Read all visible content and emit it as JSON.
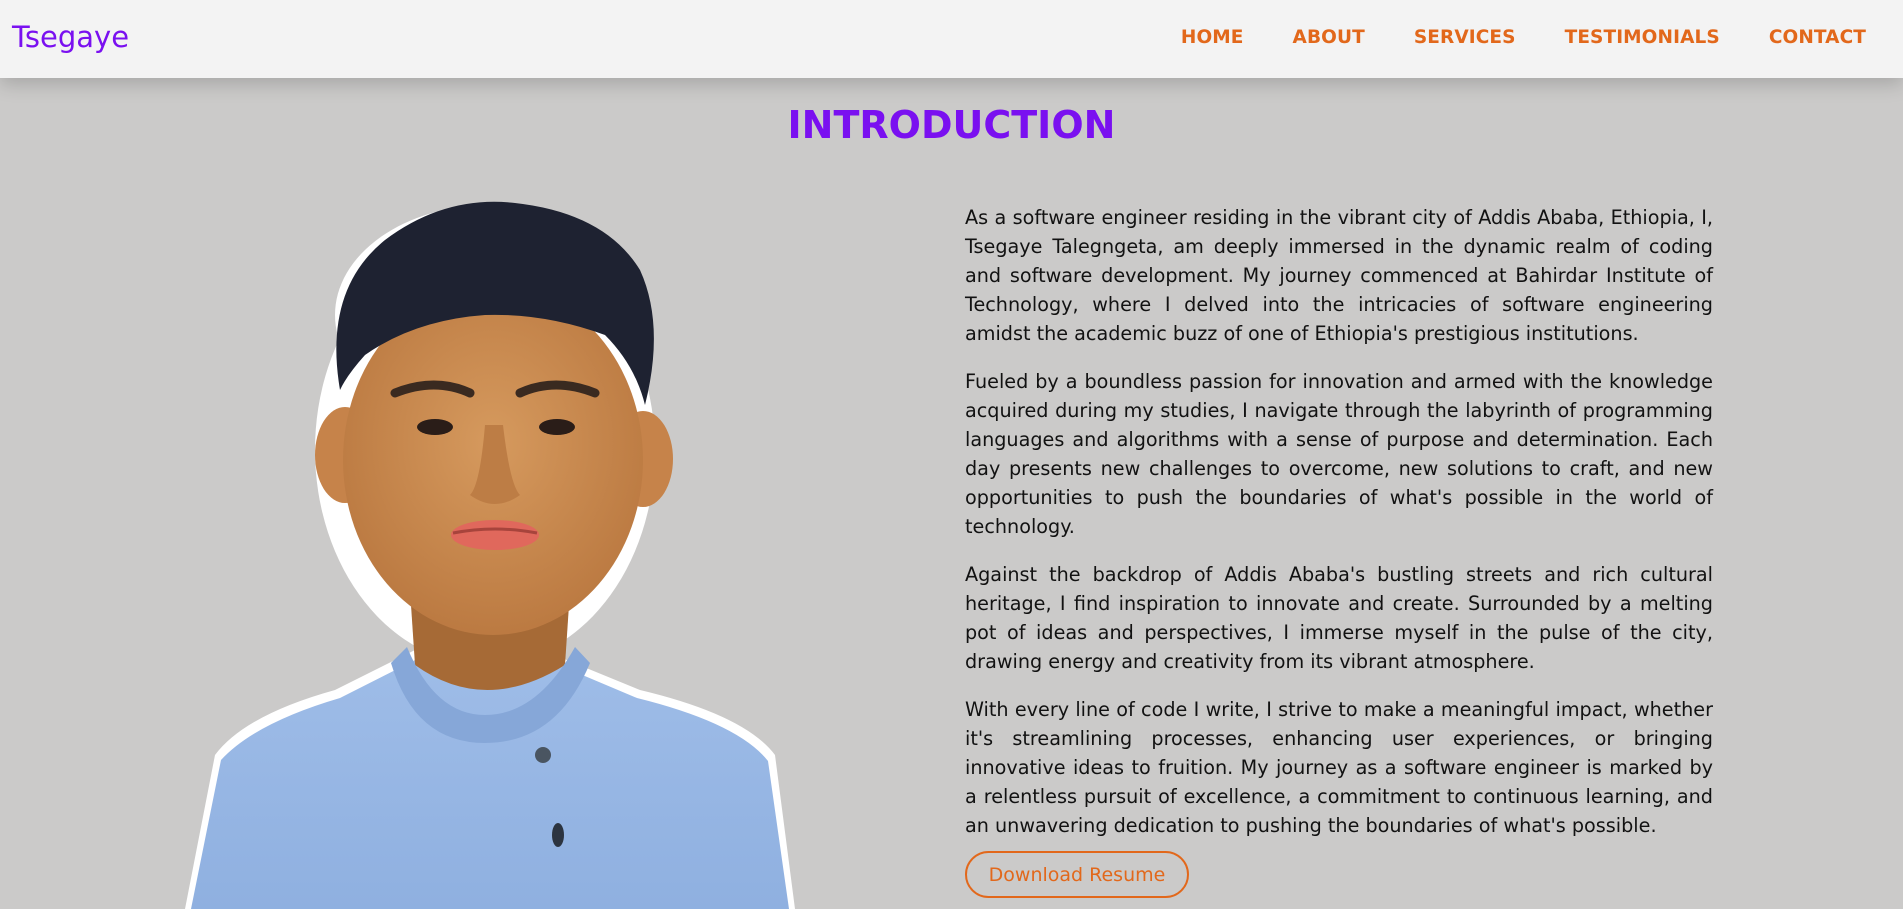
{
  "header": {
    "brand": "Tsegaye",
    "nav": [
      {
        "label": "HOME"
      },
      {
        "label": "ABOUT"
      },
      {
        "label": "SERVICES"
      },
      {
        "label": "TESTIMONIALS"
      },
      {
        "label": "CONTACT"
      }
    ]
  },
  "intro": {
    "title": "INTRODUCTION",
    "paragraphs": [
      "As a software engineer residing in the vibrant city of Addis Ababa, Ethiopia, I, Tsegaye Talegngeta, am deeply immersed in the dynamic realm of coding and software development. My journey commenced at Bahirdar Institute of Technology, where I delved into the intricacies of software engineering amidst the academic buzz of one of Ethiopia's prestigious institutions.",
      "Fueled by a boundless passion for innovation and armed with the knowledge acquired during my studies, I navigate through the labyrinth of programming languages and algorithms with a sense of purpose and determination. Each day presents new challenges to overcome, new solutions to craft, and new opportunities to push the boundaries of what's possible in the world of technology.",
      "Against the backdrop of Addis Ababa's bustling streets and rich cultural heritage, I find inspiration to innovate and create. Surrounded by a melting pot of ideas and perspectives, I immerse myself in the pulse of the city, drawing energy and creativity from its vibrant atmosphere.",
      "With every line of code I write, I strive to make a meaningful impact, whether it's streamlining processes, enhancing user experiences, or bringing innovative ideas to fruition. My journey as a software engineer is marked by a relentless pursuit of excellence, a commitment to continuous learning, and an unwavering dedication to pushing the boundaries of what's possible."
    ],
    "button_label": "Download Resume"
  },
  "colors": {
    "brand_purple": "#7a10f0",
    "accent_orange": "#e2681b",
    "page_background": "#cbcac9",
    "navbar_background": "#f3f3f3"
  }
}
